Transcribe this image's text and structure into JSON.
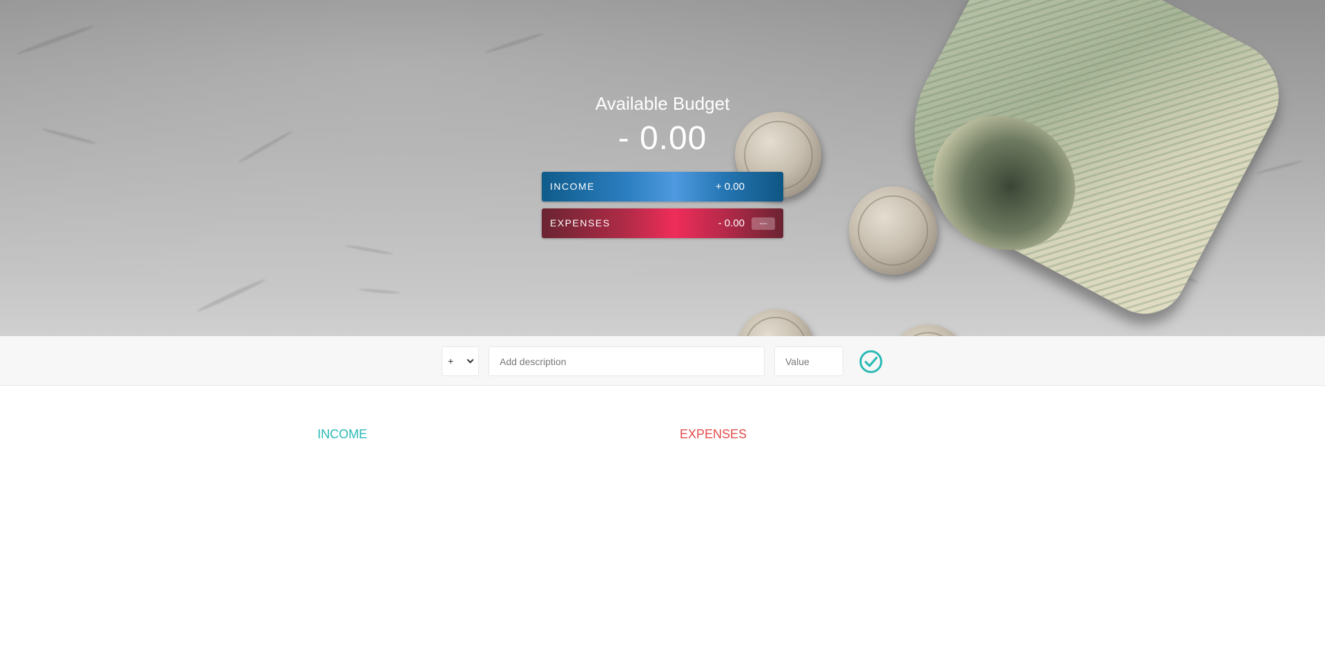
{
  "budget": {
    "title": "Available Budget",
    "value": "- 0.00"
  },
  "summary": {
    "income": {
      "label": "INCOME",
      "value": "+ 0.00",
      "color": "#2b7ec0"
    },
    "expenses": {
      "label": "EXPENSES",
      "value": "- 0.00",
      "percentage": "---",
      "color": "#ef2d5a"
    }
  },
  "add_form": {
    "type_selected": "+",
    "type_options": [
      "+",
      "-"
    ],
    "description_placeholder": "Add description",
    "description_value": "",
    "value_placeholder": "Value",
    "value_value": "",
    "submit_icon": "check-circle-icon",
    "accent_color": "#28b9b5"
  },
  "lists": {
    "income": {
      "title": "INCOME",
      "color": "#28b9b5",
      "items": []
    },
    "expenses": {
      "title": "EXPENSES",
      "color": "#e64b4b",
      "items": []
    }
  }
}
